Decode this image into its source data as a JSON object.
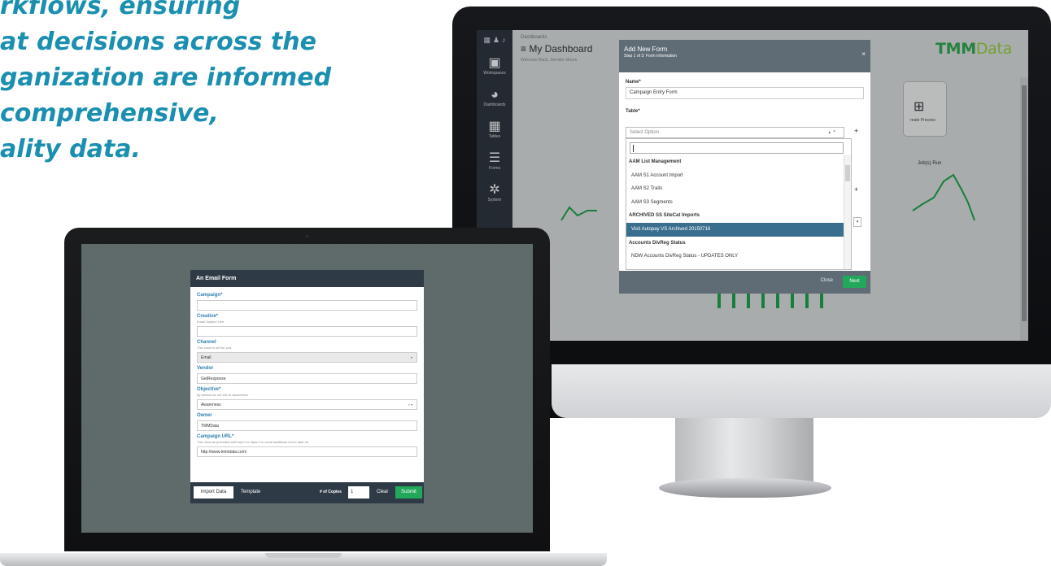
{
  "headline": {
    "lines": [
      "rkflows, ensuring",
      "at decisions across the",
      "ganization are informed",
      "comprehensive,",
      "ality data."
    ]
  },
  "dashboard": {
    "sidebar": {
      "items": [
        {
          "label": "Workspaces",
          "icon": "briefcase-icon"
        },
        {
          "label": "Dashboards",
          "icon": "palette-icon"
        },
        {
          "label": "Tables",
          "icon": "table-icon"
        },
        {
          "label": "Forms",
          "icon": "list-icon"
        },
        {
          "label": "System",
          "icon": "gear-icon"
        }
      ]
    },
    "breadcrumb": "Dashboards",
    "title": "My Dashboard",
    "welcome": "Welcome Back, Jennifer Moore",
    "logo": {
      "part1": "TMM",
      "part2": "Data",
      "color1": "#2e9f4d",
      "color2": "#8cc63f"
    },
    "process_tile_label": "reate Process",
    "jobs_label": "Job(s) Run"
  },
  "modal": {
    "title": "Add New Form",
    "step": "Step 1 of 3: Form Information",
    "close_icon": "×",
    "name_label": "Name*",
    "name_value": "Campaign Entry Form",
    "table_label": "Table*",
    "table_placeholder": "Select Option",
    "dropdown": [
      {
        "text": "AAM List Management",
        "type": "group"
      },
      {
        "text": "AAM S1 Account Import",
        "type": "option"
      },
      {
        "text": "AAM S2 Traits",
        "type": "option"
      },
      {
        "text": "AAM S3 Segments",
        "type": "option"
      },
      {
        "text": "ARCHIVED SS SiteCat Imports",
        "type": "group"
      },
      {
        "text": "Visit Autopay VS Archived 20150716",
        "type": "selected"
      },
      {
        "text": "Accounts DivReg Status",
        "type": "group"
      },
      {
        "text": "NDW Accounts DivReg Status - UPDATES ONLY",
        "type": "option"
      }
    ],
    "footer": {
      "close": "Close",
      "next": "Next"
    },
    "accent": "#22a85a"
  },
  "email_form": {
    "title": "An Email Form",
    "fields": {
      "campaign": {
        "label": "Campaign*",
        "value": ""
      },
      "creative": {
        "label": "Creative*",
        "hint": "Email Subject Line",
        "value": ""
      },
      "channel": {
        "label": "Channel",
        "hint": "This value is set for you.",
        "value": "Email"
      },
      "vendor": {
        "label": "Vendor",
        "value": "GetResponse"
      },
      "objective": {
        "label": "Objective*",
        "hint": "By default we set this to Awareness.",
        "value": "Awareness"
      },
      "owner": {
        "label": "Owner",
        "value": "TMMData"
      },
      "url": {
        "label": "Campaign URL*",
        "hint": "This must be preceded with http:// or https:// to avoid additional errors later on.",
        "value": "http://www.tmmdata.com/"
      }
    },
    "footer": {
      "import": "Import Data",
      "template": "Template",
      "copies_label": "# of Copies",
      "copies_value": "1",
      "clear": "Clear",
      "submit": "Submit"
    }
  }
}
